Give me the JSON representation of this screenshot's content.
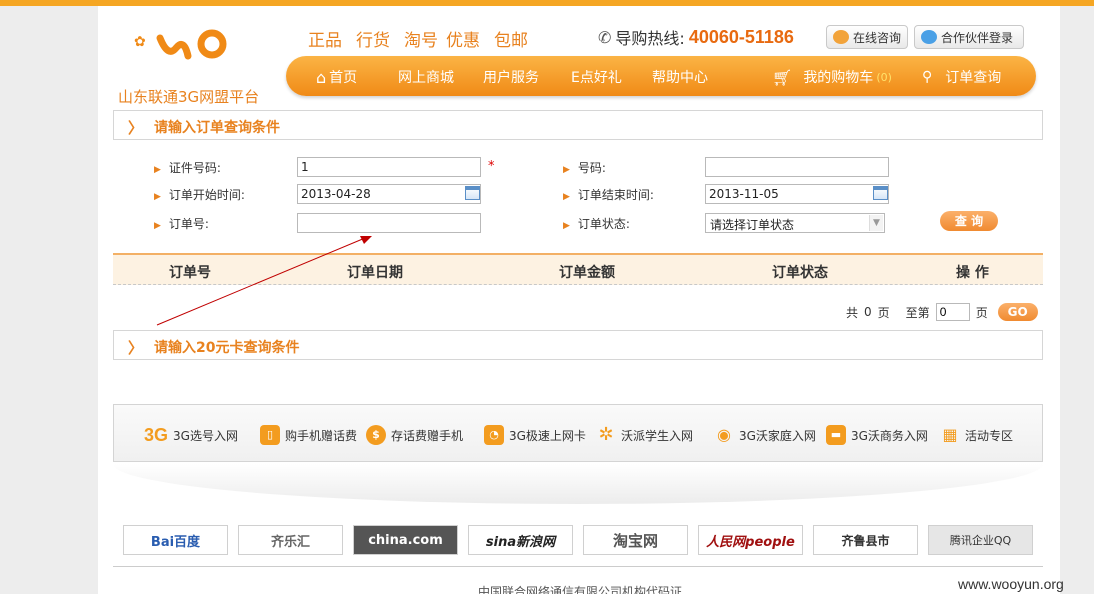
{
  "brand": {
    "logo_text": "山东联通3G网盟平台",
    "colors": {
      "accent": "#e8821f",
      "nav": "#f39a1f",
      "hotline": "#e86a10"
    }
  },
  "slogans": [
    "正品",
    "行货",
    "淘号",
    "优惠",
    "包邮"
  ],
  "hotline": {
    "label": "导购热线:",
    "number": "40060-51186"
  },
  "header_buttons": {
    "consult": "在线咨询",
    "partner_login": "合作伙伴登录"
  },
  "nav": {
    "items": [
      "首页",
      "网上商城",
      "用户服务",
      "E点好礼",
      "帮助中心"
    ],
    "cart_label": "我的购物车",
    "cart_count": "(0)",
    "order_query": "订单查询"
  },
  "order_query": {
    "title": "请输入订单查询条件",
    "fields": {
      "id_number": {
        "label": "证件号码:",
        "value": "1"
      },
      "phone": {
        "label": "号码:",
        "value": ""
      },
      "start_date": {
        "label": "订单开始时间:",
        "value": "2013-04-28"
      },
      "end_date": {
        "label": "订单结束时间:",
        "value": "2013-11-05"
      },
      "order_no": {
        "label": "订单号:",
        "value": ""
      },
      "status": {
        "label": "订单状态:",
        "value": "请选择订单状态"
      }
    },
    "required_mark": "*",
    "query_button": "查 询"
  },
  "table": {
    "columns": [
      "订单号",
      "订单日期",
      "订单金额",
      "订单状态",
      "操 作"
    ]
  },
  "pager": {
    "total_prefix": "共",
    "total": "0",
    "total_suffix": "页",
    "goto_prefix": "至第",
    "goto_value": "0",
    "goto_suffix": "页",
    "go_label": "GO"
  },
  "card_query": {
    "title": "请输入20元卡查询条件"
  },
  "features": [
    {
      "icon": "3g-icon",
      "glyph": "3G",
      "label": "3G选号入网"
    },
    {
      "icon": "phone-icon",
      "glyph": "▯",
      "label": "购手机赠话费"
    },
    {
      "icon": "dollar-icon",
      "glyph": "$",
      "label": "存话费赠手机"
    },
    {
      "icon": "rss-icon",
      "glyph": "◔",
      "label": "3G极速上网卡"
    },
    {
      "icon": "student-icon",
      "glyph": "✲",
      "label": "沃派学生入网"
    },
    {
      "icon": "family-icon",
      "glyph": "◉",
      "label": "3G沃家庭入网"
    },
    {
      "icon": "briefcase-icon",
      "glyph": "▬",
      "label": "3G沃商务入网"
    },
    {
      "icon": "grid-icon",
      "glyph": "▦",
      "label": "活动专区"
    }
  ],
  "partners": [
    "Bai百度",
    "齐乐汇",
    "china.com",
    "sina新浪网",
    "淘宝网",
    "人民网people",
    "齐鲁县市",
    "腾讯企业QQ"
  ],
  "footer": {
    "text": "中国联合网络通信有限公司机构代码证"
  },
  "watermark": "www.wooyun.org"
}
